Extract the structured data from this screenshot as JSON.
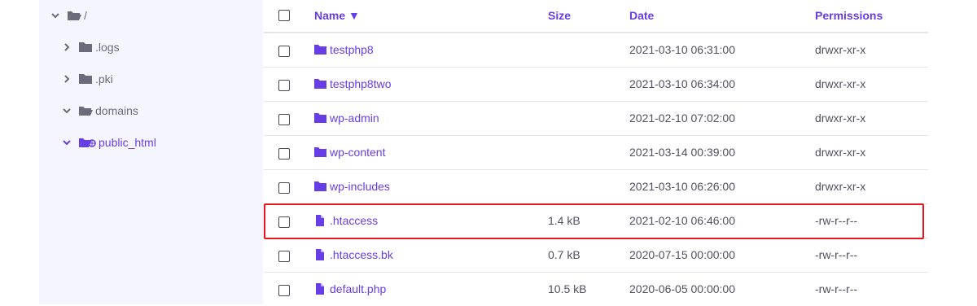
{
  "tree": {
    "root_label": "/",
    "items": [
      {
        "label": ".logs",
        "expanded": false
      },
      {
        "label": ".pki",
        "expanded": false
      },
      {
        "label": "domains",
        "expanded": true
      },
      {
        "label": "public_html",
        "expanded": true,
        "active": true
      }
    ]
  },
  "table": {
    "headers": {
      "name": "Name ▼",
      "size": "Size",
      "date": "Date",
      "permissions": "Permissions"
    },
    "rows": [
      {
        "name": "testphp8",
        "type": "folder",
        "size": "",
        "date": "2021-03-10 06:31:00",
        "permissions": "drwxr-xr-x"
      },
      {
        "name": "testphp8two",
        "type": "folder",
        "size": "",
        "date": "2021-03-10 06:34:00",
        "permissions": "drwxr-xr-x"
      },
      {
        "name": "wp-admin",
        "type": "folder",
        "size": "",
        "date": "2021-02-10 07:02:00",
        "permissions": "drwxr-xr-x"
      },
      {
        "name": "wp-content",
        "type": "folder",
        "size": "",
        "date": "2021-03-14 00:39:00",
        "permissions": "drwxr-xr-x"
      },
      {
        "name": "wp-includes",
        "type": "folder",
        "size": "",
        "date": "2021-03-10 06:26:00",
        "permissions": "drwxr-xr-x"
      },
      {
        "name": ".htaccess",
        "type": "file",
        "size": "1.4 kB",
        "date": "2021-02-10 06:46:00",
        "permissions": "-rw-r--r--",
        "highlighted": true
      },
      {
        "name": ".htaccess.bk",
        "type": "file",
        "size": "0.7 kB",
        "date": "2020-07-15 00:00:00",
        "permissions": "-rw-r--r--"
      },
      {
        "name": "default.php",
        "type": "file",
        "size": "10.5 kB",
        "date": "2020-06-05 00:00:00",
        "permissions": "-rw-r--r--"
      }
    ]
  },
  "colors": {
    "accent": "#673de6",
    "sidebar_bg": "#f4f5ff",
    "highlight": "#e8141b",
    "folder_gray": "#6b6b7b"
  }
}
